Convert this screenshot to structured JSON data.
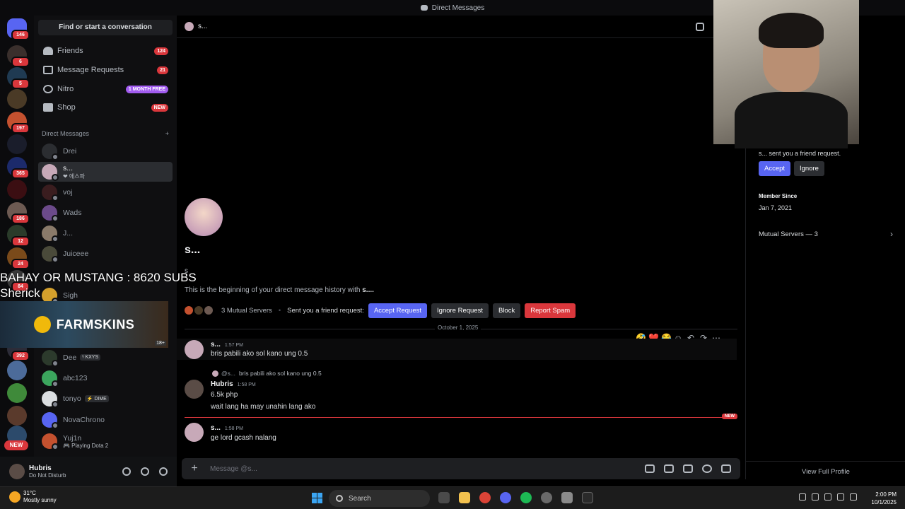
{
  "window": {
    "title": "Direct Messages"
  },
  "rail": {
    "badges": [
      "146",
      "6",
      "5",
      "197",
      "365",
      "186",
      "12",
      "24",
      "84",
      "392"
    ],
    "new_label": "NEW"
  },
  "sidebar": {
    "find_placeholder": "Find or start a conversation",
    "nav": [
      {
        "label": "Friends",
        "badge": "124"
      },
      {
        "label": "Message Requests",
        "badge": "21"
      },
      {
        "label": "Nitro",
        "badge": "1 MONTH FREE"
      },
      {
        "label": "Shop",
        "badge": "NEW"
      }
    ],
    "dm_header": "Direct Messages",
    "dm_add": "+",
    "dms": [
      {
        "name": "Drei"
      },
      {
        "name": "s...",
        "status": "❤ 에스파"
      },
      {
        "name": "voj"
      },
      {
        "name": "Wads"
      },
      {
        "name": "J..."
      },
      {
        "name": "Juiceee"
      },
      {
        "name": "Sigh"
      },
      {
        "name": "Dee",
        "tag": "ᵞ KXYS"
      },
      {
        "name": "abc123"
      },
      {
        "name": "tonyo",
        "tag": "⚡ DIME"
      },
      {
        "name": "NovaChrono"
      },
      {
        "name": "Yuj1n",
        "status": "🎮 Playing Dota 2"
      }
    ]
  },
  "overlay": {
    "line1": "BAHAY OR MUSTANG : 8620 SUBS",
    "line2": "Sherick",
    "banner": "FARMSKINS",
    "banner_age": "18+"
  },
  "chat": {
    "header_name": "s...",
    "intro_name": "s...",
    "intro_sub": "s",
    "beginning_prefix": "This is the beginning of your direct message history with ",
    "beginning_name": "s....",
    "mutual_servers": "3 Mutual Servers",
    "request_text": "Sent you a friend request:",
    "accept": "Accept Request",
    "ignore": "Ignore Request",
    "block": "Block",
    "report": "Report Spam",
    "date_divider": "October 1, 2025",
    "new_label": "NEW",
    "messages": [
      {
        "author": "s...",
        "time": "1:57 PM",
        "text": "bris pabili ako sol kano ung 0.5"
      },
      {
        "reply_author": "@s...",
        "reply_text": "bris pabili ako sol kano ung 0.5",
        "author": "Hubris",
        "time": "1:58 PM",
        "text": "6.5k php",
        "text2": "wait lang ha may unahin lang ako"
      },
      {
        "author": "s...",
        "time": "1:58 PM",
        "text": "ge lord gcash nalang"
      }
    ],
    "hover_reactions": [
      "🤣",
      "❤️",
      "😂"
    ],
    "composer_placeholder": "Message @s..."
  },
  "profile": {
    "request_text": "s... sent you a friend request.",
    "accept": "Accept",
    "ignore": "Ignore",
    "member_since_label": "Member Since",
    "member_since": "Jan 7, 2021",
    "mutual_servers": "Mutual Servers — 3",
    "view_full": "View Full Profile"
  },
  "user": {
    "name": "Hubris",
    "status": "Do Not Disturb"
  },
  "taskbar": {
    "temp": "31°C",
    "weather": "Mostly sunny",
    "search": "Search",
    "time": "2:00 PM",
    "date": "10/1/2025"
  },
  "colors": {
    "blurple": "#5865f2",
    "danger": "#da373c",
    "background": "#000000"
  }
}
